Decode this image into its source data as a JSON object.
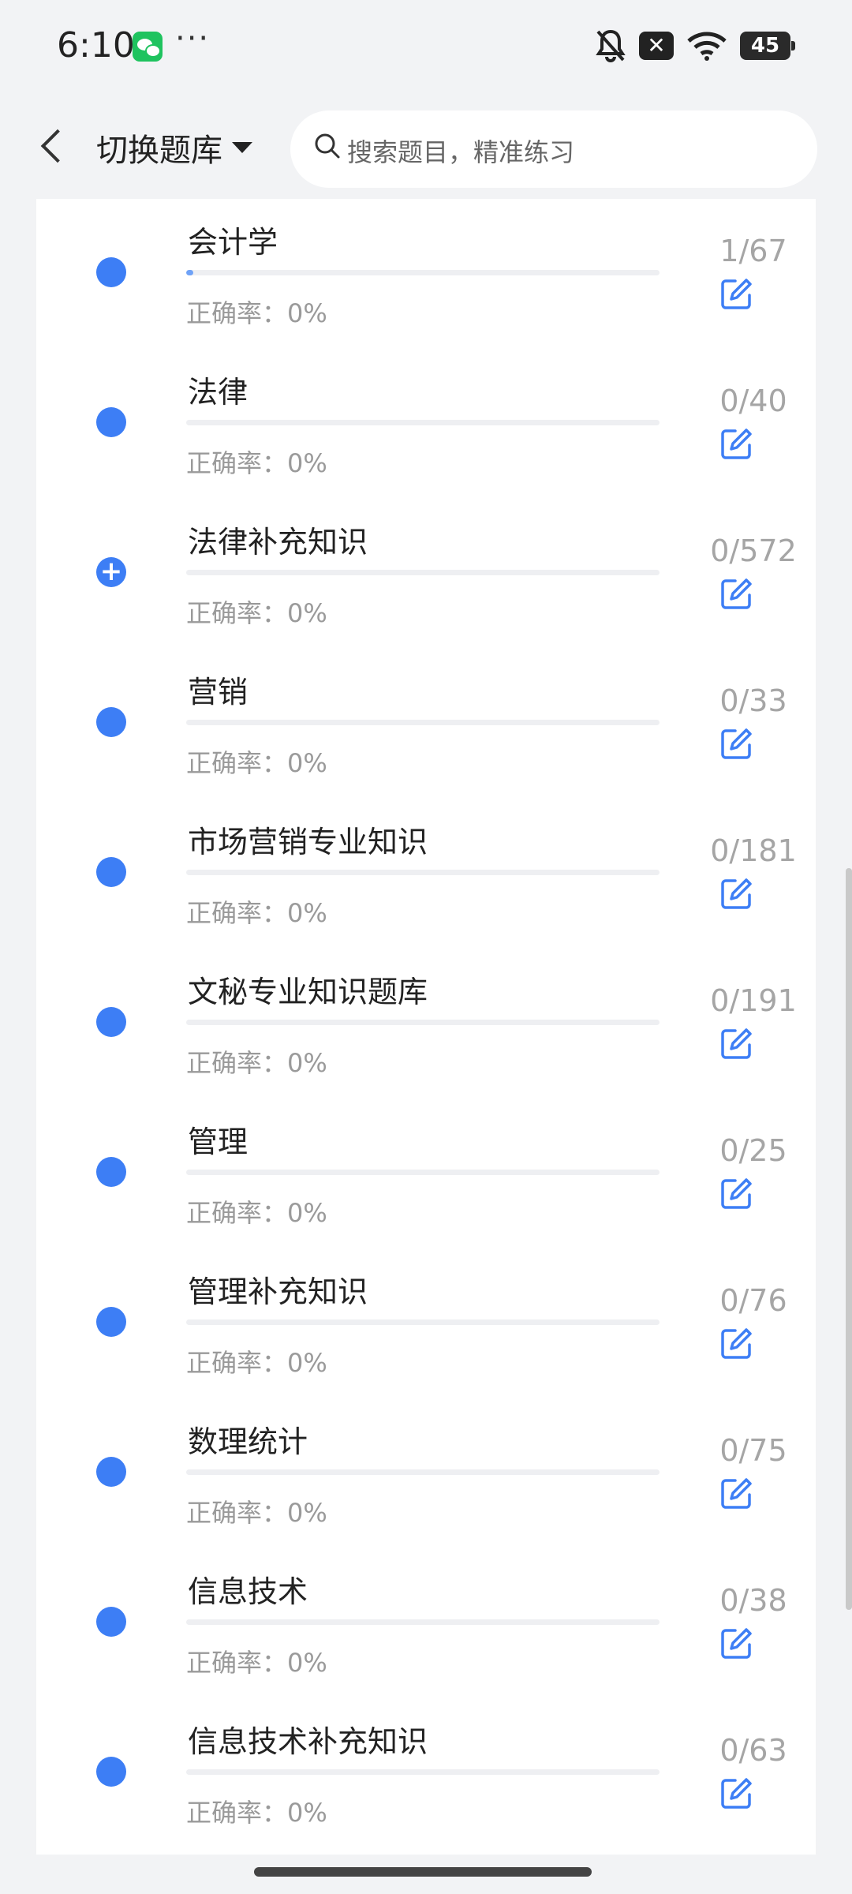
{
  "status": {
    "time": "6:10",
    "battery": "45",
    "more": "···"
  },
  "header": {
    "bank_switch_label": "切换题库",
    "search_placeholder": "搜索题目，精准练习"
  },
  "accuracy_prefix": "正确率：",
  "colors": {
    "accent": "#3d7ef5",
    "progress_fill": "#6fa2f7",
    "muted": "#9a9a9a"
  },
  "items": [
    {
      "name": "会计学",
      "count": "1/67",
      "accuracy": "0%",
      "progress": 0.015,
      "expanded": false
    },
    {
      "name": "法律",
      "count": "0/40",
      "accuracy": "0%",
      "progress": 0,
      "expanded": false
    },
    {
      "name": "法律补充知识",
      "count": "0/572",
      "accuracy": "0%",
      "progress": 0,
      "expanded": true
    },
    {
      "name": "营销",
      "count": "0/33",
      "accuracy": "0%",
      "progress": 0,
      "expanded": false
    },
    {
      "name": "市场营销专业知识",
      "count": "0/181",
      "accuracy": "0%",
      "progress": 0,
      "expanded": false
    },
    {
      "name": "文秘专业知识题库",
      "count": "0/191",
      "accuracy": "0%",
      "progress": 0,
      "expanded": false
    },
    {
      "name": "管理",
      "count": "0/25",
      "accuracy": "0%",
      "progress": 0,
      "expanded": false
    },
    {
      "name": "管理补充知识",
      "count": "0/76",
      "accuracy": "0%",
      "progress": 0,
      "expanded": false
    },
    {
      "name": "数理统计",
      "count": "0/75",
      "accuracy": "0%",
      "progress": 0,
      "expanded": false
    },
    {
      "name": "信息技术",
      "count": "0/38",
      "accuracy": "0%",
      "progress": 0,
      "expanded": false
    },
    {
      "name": "信息技术补充知识",
      "count": "0/63",
      "accuracy": "0%",
      "progress": 0,
      "expanded": false
    }
  ]
}
